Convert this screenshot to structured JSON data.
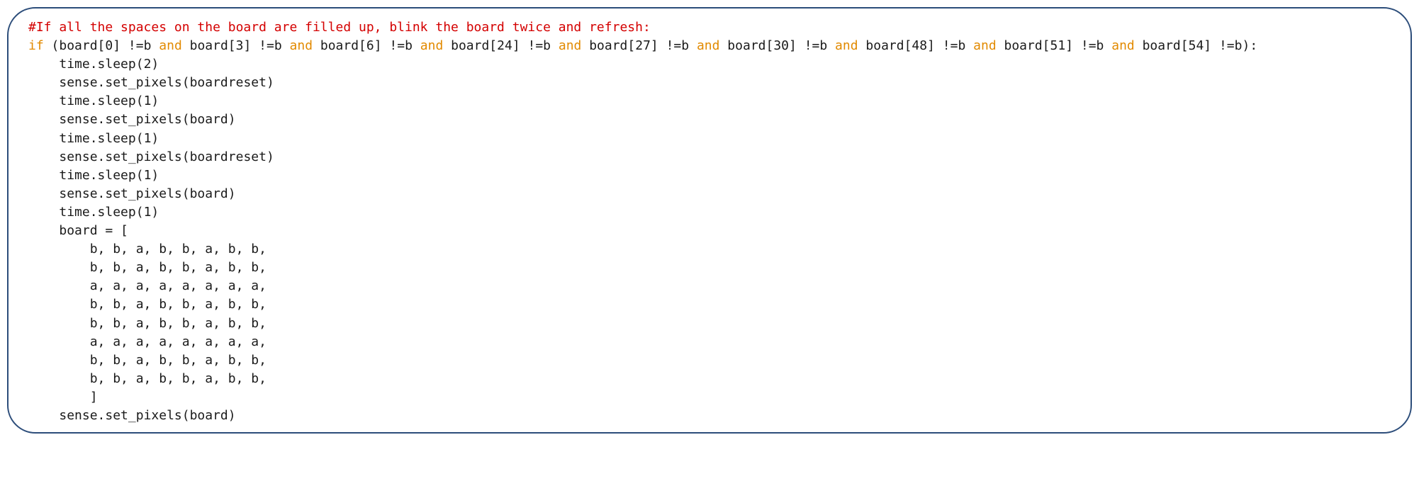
{
  "code": {
    "lines": [
      {
        "indent": 0,
        "spans": [
          {
            "cls": "c-comment",
            "t": "#If all the spaces on the board are filled up, blink the board twice and refresh:"
          }
        ]
      },
      {
        "indent": 0,
        "spans": [
          {
            "cls": "c-kw",
            "t": "if"
          },
          {
            "cls": "c-id",
            "t": " (board["
          },
          {
            "cls": "c-op",
            "t": "0"
          },
          {
            "cls": "c-id",
            "t": "] !=b "
          },
          {
            "cls": "c-kw",
            "t": "and"
          },
          {
            "cls": "c-id",
            "t": " board["
          },
          {
            "cls": "c-op",
            "t": "3"
          },
          {
            "cls": "c-id",
            "t": "] !=b "
          },
          {
            "cls": "c-kw",
            "t": "and"
          },
          {
            "cls": "c-id",
            "t": " board["
          },
          {
            "cls": "c-op",
            "t": "6"
          },
          {
            "cls": "c-id",
            "t": "] !=b "
          },
          {
            "cls": "c-kw",
            "t": "and"
          },
          {
            "cls": "c-id",
            "t": " board["
          },
          {
            "cls": "c-op",
            "t": "24"
          },
          {
            "cls": "c-id",
            "t": "] !=b "
          },
          {
            "cls": "c-kw",
            "t": "and"
          },
          {
            "cls": "c-id",
            "t": " board["
          },
          {
            "cls": "c-op",
            "t": "27"
          },
          {
            "cls": "c-id",
            "t": "] !=b "
          },
          {
            "cls": "c-kw",
            "t": "and"
          },
          {
            "cls": "c-id",
            "t": " board["
          },
          {
            "cls": "c-op",
            "t": "30"
          },
          {
            "cls": "c-id",
            "t": "] !=b "
          },
          {
            "cls": "c-kw",
            "t": "and"
          },
          {
            "cls": "c-id",
            "t": " board["
          },
          {
            "cls": "c-op",
            "t": "48"
          },
          {
            "cls": "c-id",
            "t": "] !=b "
          },
          {
            "cls": "c-kw",
            "t": "and"
          },
          {
            "cls": "c-id",
            "t": " board["
          },
          {
            "cls": "c-op",
            "t": "51"
          },
          {
            "cls": "c-id",
            "t": "] !=b "
          },
          {
            "cls": "c-kw",
            "t": "and"
          },
          {
            "cls": "c-id",
            "t": " board["
          },
          {
            "cls": "c-op",
            "t": "54"
          },
          {
            "cls": "c-id",
            "t": "] !=b):"
          }
        ]
      },
      {
        "indent": 1,
        "spans": [
          {
            "cls": "c-id",
            "t": "time.sleep("
          },
          {
            "cls": "c-op",
            "t": "2"
          },
          {
            "cls": "c-id",
            "t": ")"
          }
        ]
      },
      {
        "indent": 1,
        "spans": [
          {
            "cls": "c-id",
            "t": "sense.set_pixels(boardreset)"
          }
        ]
      },
      {
        "indent": 1,
        "spans": [
          {
            "cls": "c-id",
            "t": "time.sleep("
          },
          {
            "cls": "c-op",
            "t": "1"
          },
          {
            "cls": "c-id",
            "t": ")"
          }
        ]
      },
      {
        "indent": 1,
        "spans": [
          {
            "cls": "c-id",
            "t": "sense.set_pixels(board)"
          }
        ]
      },
      {
        "indent": 1,
        "spans": [
          {
            "cls": "c-id",
            "t": "time.sleep("
          },
          {
            "cls": "c-op",
            "t": "1"
          },
          {
            "cls": "c-id",
            "t": ")"
          }
        ]
      },
      {
        "indent": 1,
        "spans": [
          {
            "cls": "c-id",
            "t": "sense.set_pixels(boardreset)"
          }
        ]
      },
      {
        "indent": 1,
        "spans": [
          {
            "cls": "c-id",
            "t": "time.sleep("
          },
          {
            "cls": "c-op",
            "t": "1"
          },
          {
            "cls": "c-id",
            "t": ")"
          }
        ]
      },
      {
        "indent": 1,
        "spans": [
          {
            "cls": "c-id",
            "t": "sense.set_pixels(board)"
          }
        ]
      },
      {
        "indent": 1,
        "spans": [
          {
            "cls": "c-id",
            "t": "time.sleep("
          },
          {
            "cls": "c-op",
            "t": "1"
          },
          {
            "cls": "c-id",
            "t": ")"
          }
        ]
      },
      {
        "indent": 1,
        "spans": [
          {
            "cls": "c-id",
            "t": "board = ["
          }
        ]
      },
      {
        "indent": 2,
        "spans": [
          {
            "cls": "c-id",
            "t": "b, b, a, b, b, a, b, b,"
          }
        ]
      },
      {
        "indent": 2,
        "spans": [
          {
            "cls": "c-id",
            "t": "b, b, a, b, b, a, b, b,"
          }
        ]
      },
      {
        "indent": 2,
        "spans": [
          {
            "cls": "c-id",
            "t": "a, a, a, a, a, a, a, a,"
          }
        ]
      },
      {
        "indent": 2,
        "spans": [
          {
            "cls": "c-id",
            "t": "b, b, a, b, b, a, b, b,"
          }
        ]
      },
      {
        "indent": 2,
        "spans": [
          {
            "cls": "c-id",
            "t": "b, b, a, b, b, a, b, b,"
          }
        ]
      },
      {
        "indent": 2,
        "spans": [
          {
            "cls": "c-id",
            "t": "a, a, a, a, a, a, a, a,"
          }
        ]
      },
      {
        "indent": 2,
        "spans": [
          {
            "cls": "c-id",
            "t": "b, b, a, b, b, a, b, b,"
          }
        ]
      },
      {
        "indent": 2,
        "spans": [
          {
            "cls": "c-id",
            "t": "b, b, a, b, b, a, b, b,"
          }
        ]
      },
      {
        "indent": 2,
        "spans": [
          {
            "cls": "c-id",
            "t": "]"
          }
        ]
      },
      {
        "indent": 1,
        "spans": [
          {
            "cls": "c-id",
            "t": "sense.set_pixels(board)"
          }
        ]
      }
    ]
  }
}
